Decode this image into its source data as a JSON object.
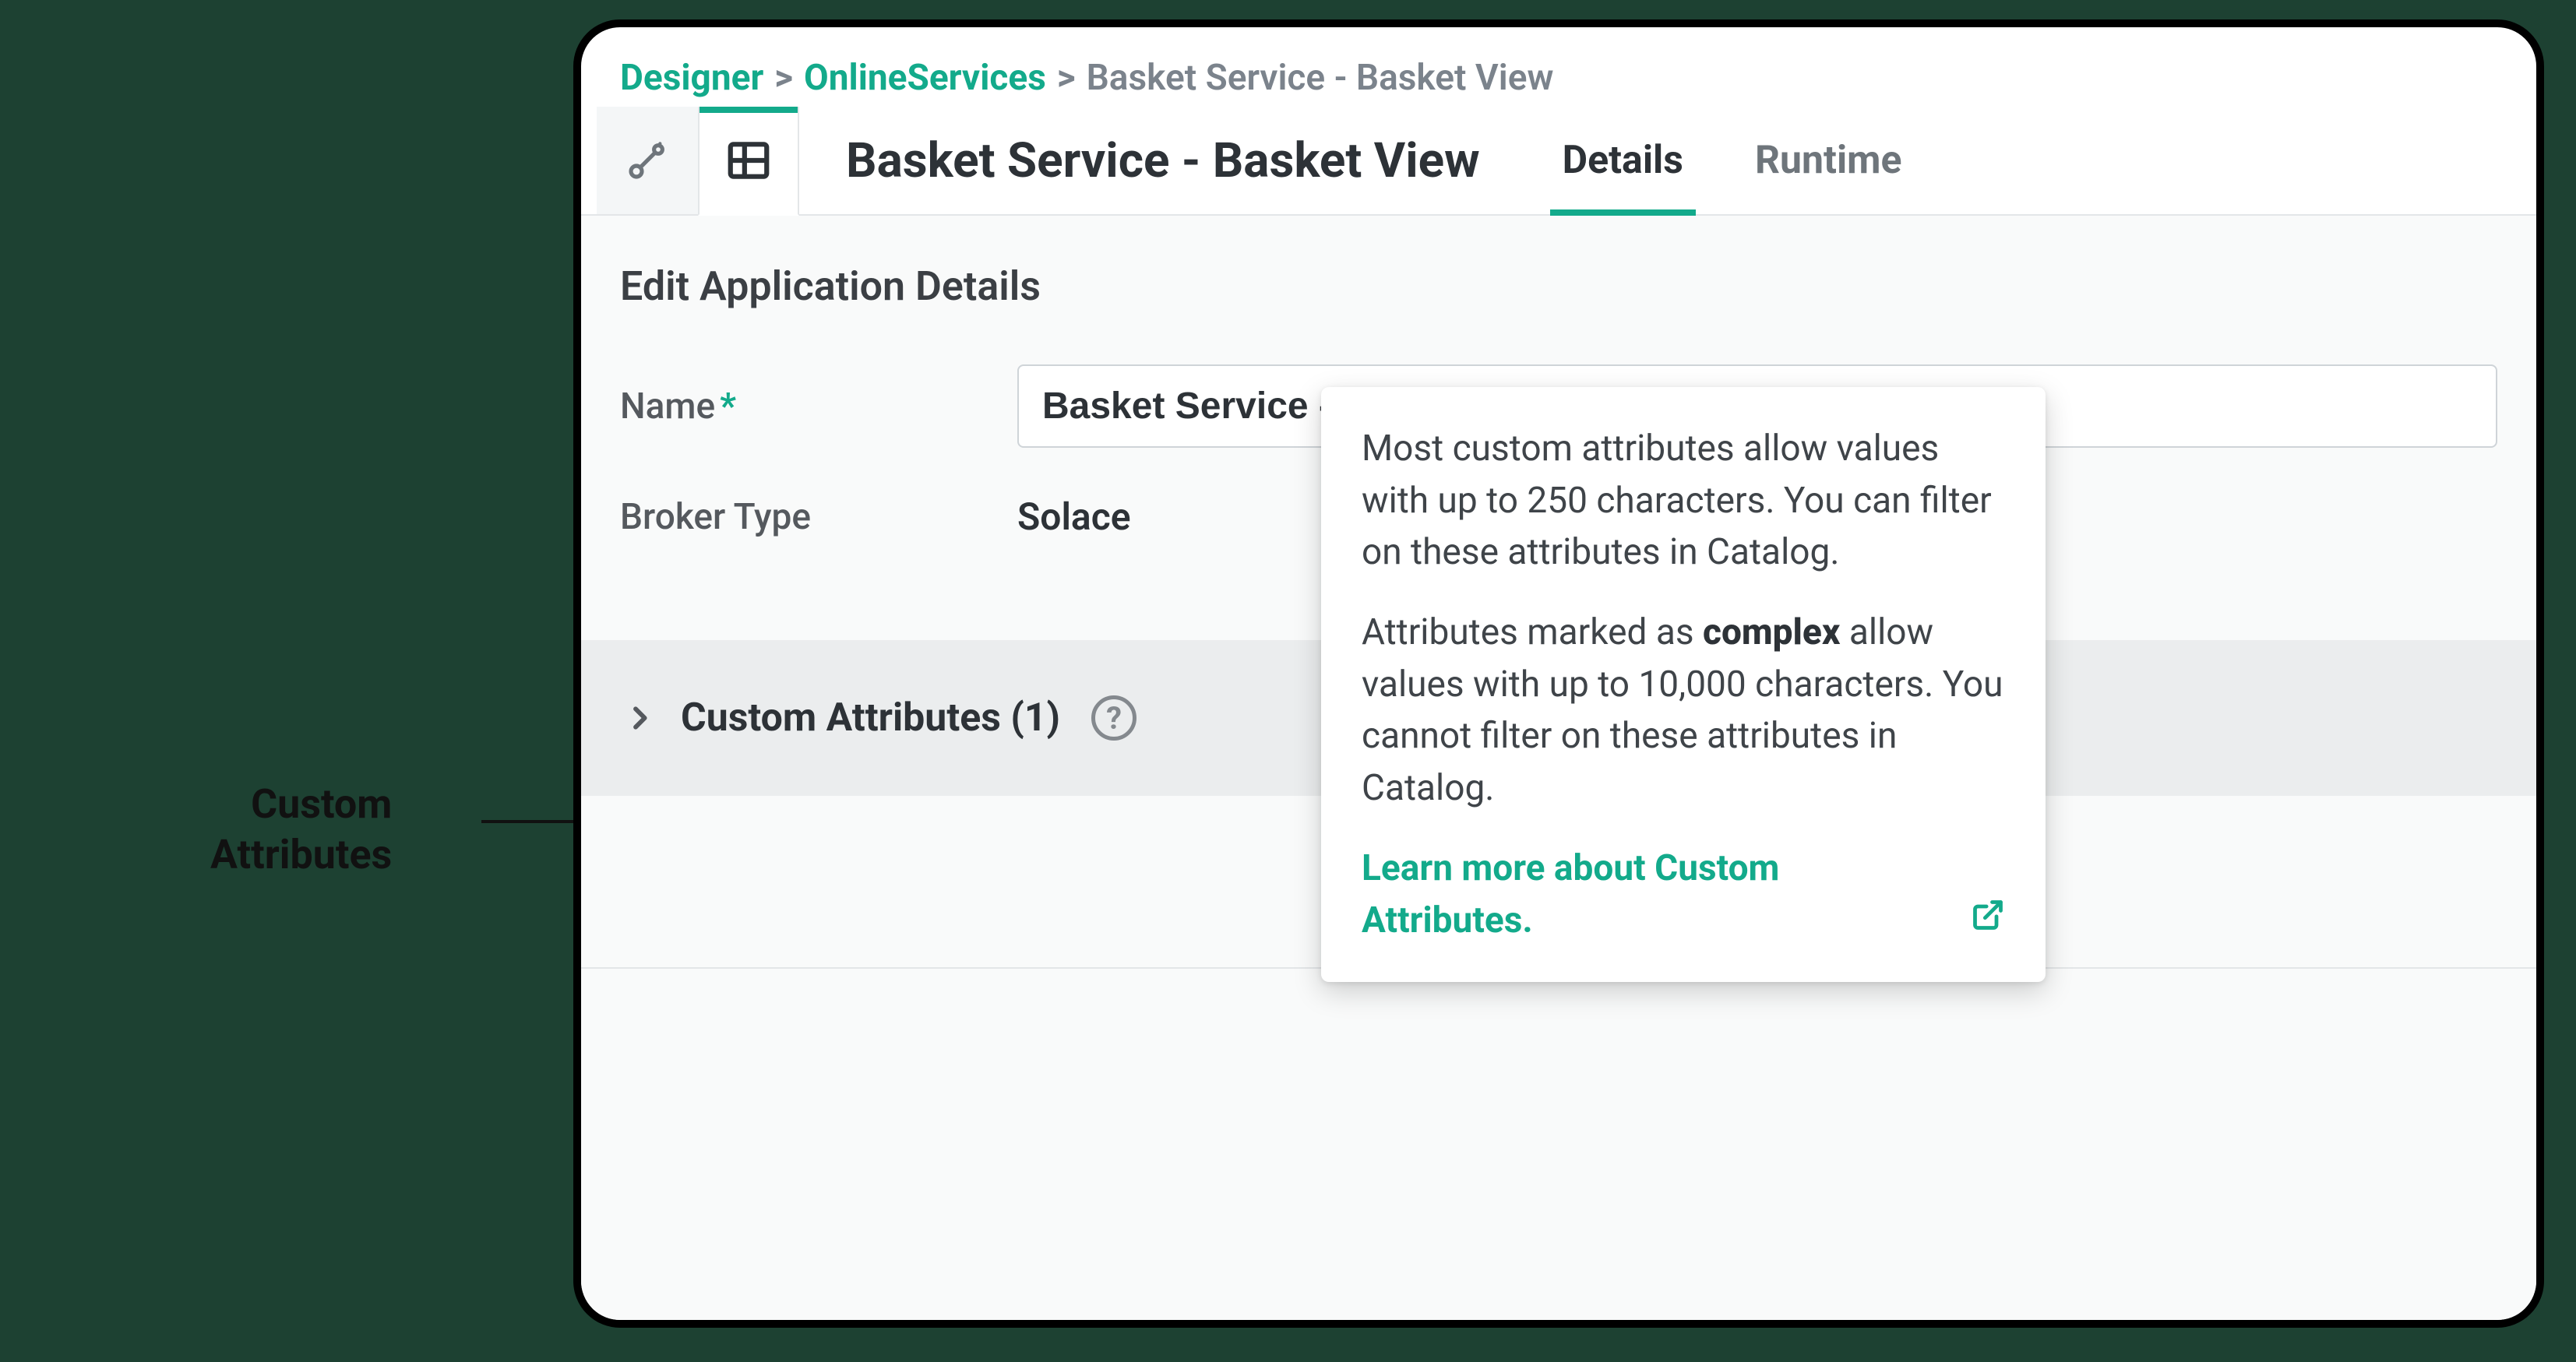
{
  "annotation": {
    "line1": "Custom",
    "line2": "Attributes"
  },
  "breadcrumb": {
    "items": [
      "Designer",
      "OnlineServices",
      "Basket Service - Basket View"
    ],
    "sep": ">"
  },
  "page": {
    "title": "Basket Service - Basket View"
  },
  "tabs": {
    "details": "Details",
    "runtime": "Runtime"
  },
  "form": {
    "section_title": "Edit Application Details",
    "name_label": "Name",
    "name_required": "*",
    "name_value": "Basket Service - Basket View",
    "broker_label": "Broker Type",
    "broker_value": "Solace"
  },
  "custom_attrs": {
    "title": "Custom Attributes (1)",
    "help_glyph": "?"
  },
  "tooltip": {
    "p1": "Most custom attributes allow values with up to 250 characters. You can filter on these attributes in Catalog.",
    "p2a": "Attributes marked as ",
    "p2b": "complex",
    "p2c": " allow values with up to 10,000 characters. You cannot filter on these attributes in Catalog.",
    "link": "Learn more about Custom Attributes."
  }
}
